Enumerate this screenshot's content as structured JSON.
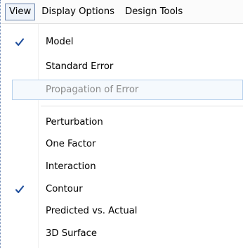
{
  "menubar": {
    "items": [
      {
        "label": "View",
        "active": true
      },
      {
        "label": "Display Options"
      },
      {
        "label": "Design Tools"
      }
    ]
  },
  "view_menu": {
    "items": [
      {
        "label": "Model",
        "checked": true
      },
      {
        "label": "Standard Error"
      },
      {
        "label": "Propagation of Error",
        "disabled": true,
        "hovered": true
      },
      {
        "label": "Perturbation"
      },
      {
        "label": "One Factor"
      },
      {
        "label": "Interaction"
      },
      {
        "label": "Contour",
        "checked": true
      },
      {
        "label": "Predicted vs. Actual"
      },
      {
        "label": "3D Surface"
      }
    ]
  },
  "colors": {
    "checkmark": "#1f4e9c",
    "active_border": "#6e87ad",
    "hover_border": "#b8d1ec",
    "disabled_text": "#8a8a8a"
  }
}
